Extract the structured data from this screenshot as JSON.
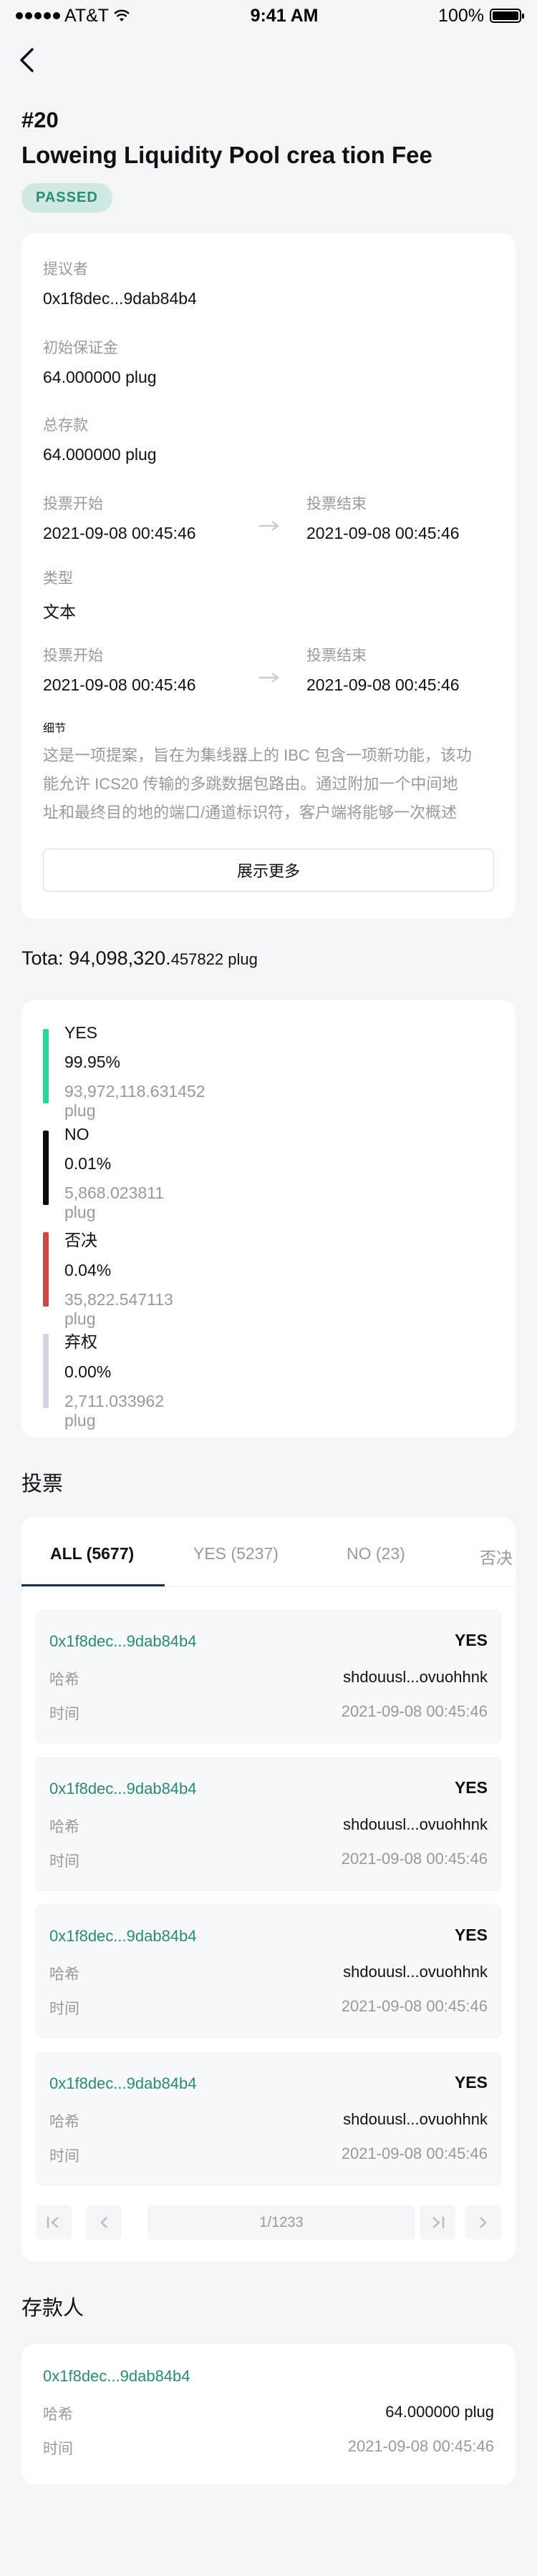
{
  "status_bar": {
    "carrier": "AT&T",
    "time": "9:41 AM",
    "battery": "100%"
  },
  "proposal": {
    "number": "#20",
    "title": "Loweing Liquidity Pool crea tion Fee",
    "status": "PASSED"
  },
  "details": {
    "proposer_label": "提议者",
    "proposer_value": "0x1f8dec...9dab84b4",
    "initial_deposit_label": "初始保证金",
    "initial_deposit_value": "64.000000 plug",
    "total_deposit_label": "总存款",
    "total_deposit_value": "64.000000 plug",
    "vote_start_label": "投票开始",
    "vote_start_value": "2021-09-08 00:45:46",
    "vote_end_label": "投票结束",
    "vote_end_value": "2021-09-08 00:45:46",
    "type_label": "类型",
    "type_value": "文本",
    "vote_start2_label": "投票开始",
    "vote_start2_value": "2021-09-08 00:45:46",
    "vote_end2_label": "投票结束",
    "vote_end2_value": "2021-09-08 00:45:46",
    "detail_label": "细节",
    "detail_lines": [
      "这是一项提案，旨在为集线器上的 IBC 包含一项新功能，该功",
      "能允许 ICS20 传输的多跳数据包路由。通过附加一个中间地",
      "址和最终目的地的端口/通道标识符，客户端将能够一次概述"
    ],
    "show_more": "展示更多"
  },
  "total": {
    "prefix": "Tota: ",
    "main": "94,098,320.",
    "small": "457822 plug"
  },
  "vote_results": [
    {
      "name": "YES",
      "percent": "99.95%",
      "amount": "93,972,118.631452 plug",
      "color": "#2ed3a0"
    },
    {
      "name": "NO",
      "percent": "0.01%",
      "amount": "5,868.023811 plug",
      "color": "#0a0a0a"
    },
    {
      "name": "否决",
      "percent": "0.04%",
      "amount": "35,822.547113 plug",
      "color": "#d04545"
    },
    {
      "name": "弃权",
      "percent": "0.00%",
      "amount": "2,711.033962 plug",
      "color": "#d3d6e2"
    }
  ],
  "votes_section": {
    "title": "投票",
    "tabs": [
      "ALL (5677)",
      "YES (5237)",
      "NO (23)",
      "否决"
    ],
    "entries": [
      {
        "address": "0x1f8dec...9dab84b4",
        "option": "YES",
        "hash_label": "哈希",
        "hash": "shdouusl...ovuohhnk",
        "time_label": "时间",
        "time": "2021-09-08 00:45:46"
      },
      {
        "address": "0x1f8dec...9dab84b4",
        "option": "YES",
        "hash_label": "哈希",
        "hash": "shdouusl...ovuohhnk",
        "time_label": "时间",
        "time": "2021-09-08 00:45:46"
      },
      {
        "address": "0x1f8dec...9dab84b4",
        "option": "YES",
        "hash_label": "哈希",
        "hash": "shdouusl...ovuohhnk",
        "time_label": "时间",
        "time": "2021-09-08 00:45:46"
      },
      {
        "address": "0x1f8dec...9dab84b4",
        "option": "YES",
        "hash_label": "哈希",
        "hash": "shdouusl...ovuohhnk",
        "time_label": "时间",
        "time": "2021-09-08 00:45:46"
      }
    ],
    "pagination": "1/1233"
  },
  "depositors_section": {
    "title": "存款人",
    "entry": {
      "address": "0x1f8dec...9dab84b4",
      "hash_label": "哈希",
      "amount": "64.000000 plug",
      "time_label": "时间",
      "time": "2021-09-08 00:45:46"
    }
  }
}
